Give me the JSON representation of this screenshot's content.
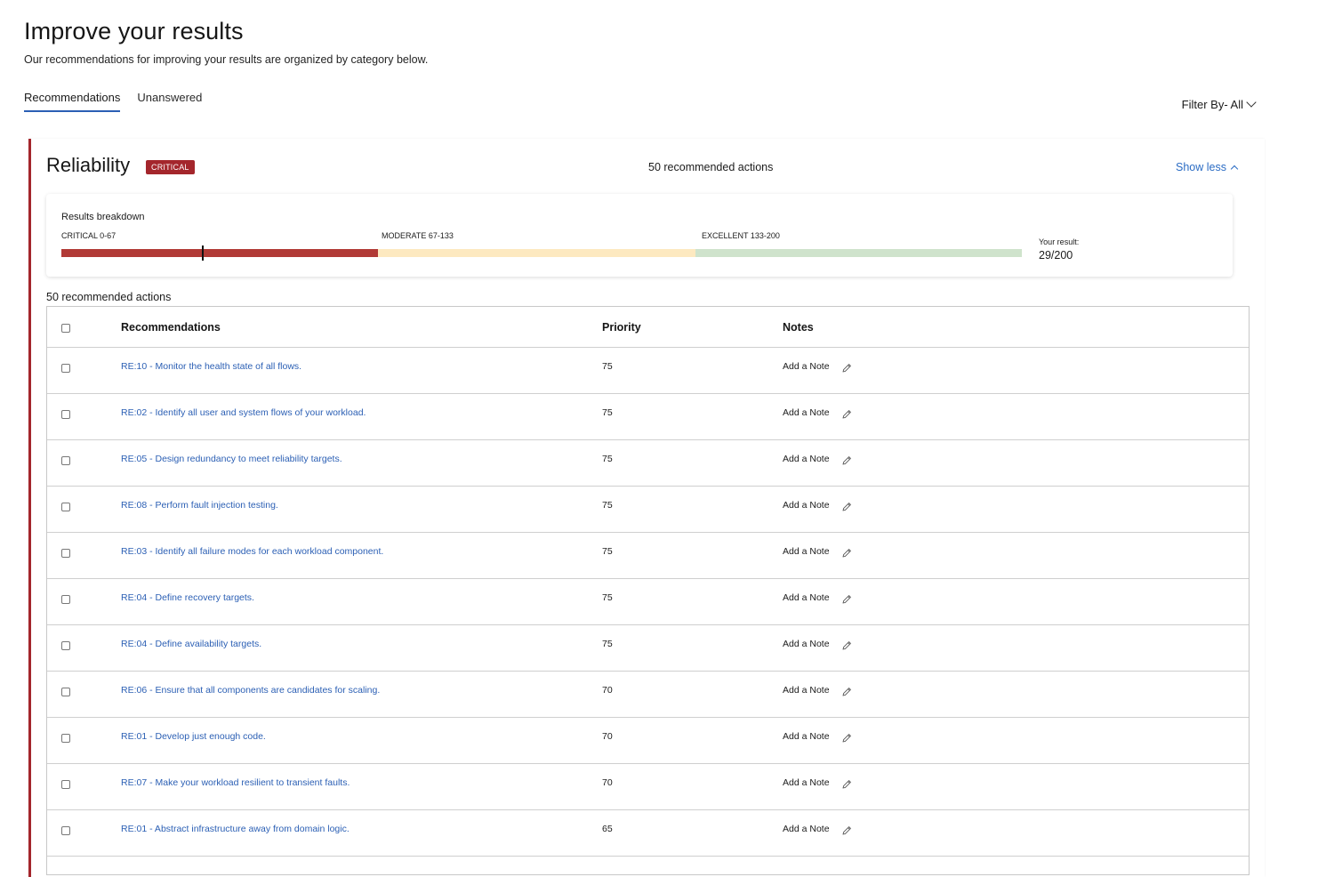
{
  "page": {
    "title": "Improve your results",
    "subtitle": "Our recommendations for improving your results are organized by category below."
  },
  "tabs": [
    {
      "label": "Recommendations",
      "active": true
    },
    {
      "label": "Unanswered",
      "active": false
    }
  ],
  "filter": {
    "label": "Filter By- All"
  },
  "category": {
    "title": "Reliability",
    "badge": "CRITICAL",
    "recommended_actions": "50 recommended actions",
    "toggle_label": "Show less",
    "accent_color": "#a4262c"
  },
  "breakdown": {
    "title": "Results breakdown",
    "segments": [
      {
        "label": "CRITICAL 0-67",
        "color": "#b13a36"
      },
      {
        "label": "MODERATE 67-133",
        "color": "#fde9c0"
      },
      {
        "label": "EXCELLENT 133-200",
        "color": "#cfe3cc"
      }
    ],
    "result_label": "Your result:",
    "result_value": "29/200"
  },
  "table": {
    "count_label": "50 recommended actions",
    "headers": {
      "recommendations": "Recommendations",
      "priority": "Priority",
      "notes": "Notes"
    },
    "note_action": "Add a Note",
    "rows": [
      {
        "text": "RE:10 - Monitor the health state of all flows.",
        "priority": "75"
      },
      {
        "text": "RE:02 - Identify all user and system flows of your workload.",
        "priority": "75"
      },
      {
        "text": "RE:05 - Design redundancy to meet reliability targets.",
        "priority": "75"
      },
      {
        "text": "RE:08 - Perform fault injection testing.",
        "priority": "75"
      },
      {
        "text": "RE:03 - Identify all failure modes for each workload component.",
        "priority": "75"
      },
      {
        "text": "RE:04 - Define recovery targets.",
        "priority": "75"
      },
      {
        "text": "RE:04 - Define availability targets.",
        "priority": "75"
      },
      {
        "text": "RE:06 - Ensure that all components are candidates for scaling.",
        "priority": "70"
      },
      {
        "text": "RE:01 - Develop just enough code.",
        "priority": "70"
      },
      {
        "text": "RE:07 - Make your workload resilient to transient faults.",
        "priority": "70"
      },
      {
        "text": "RE:01 - Abstract infrastructure away from domain logic.",
        "priority": "65"
      }
    ]
  }
}
